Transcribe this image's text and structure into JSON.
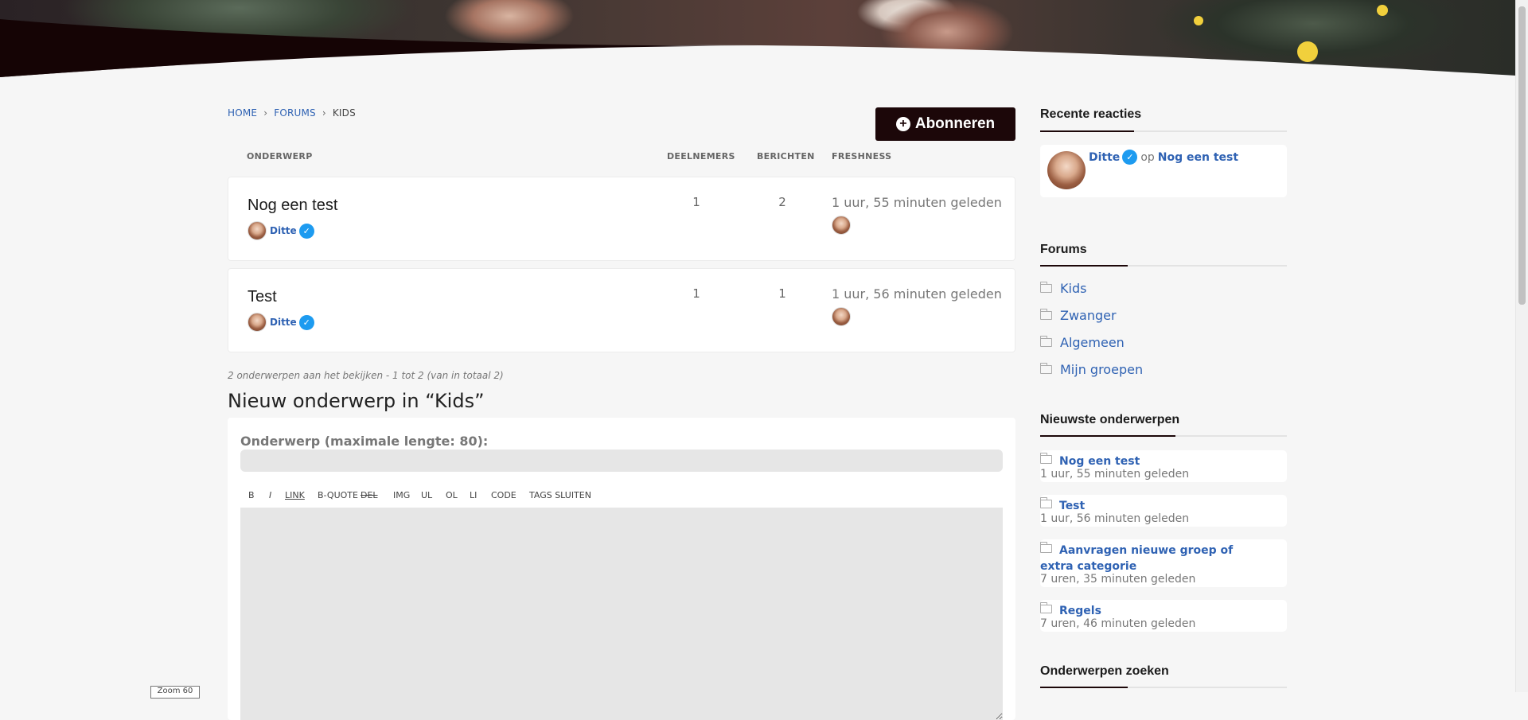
{
  "breadcrumb": {
    "home": "HOME",
    "forums": "FORUMS",
    "current": "KIDS",
    "sep": "›"
  },
  "subscribe_label": "Abonneren",
  "table_headers": {
    "topic": "ONDERWERP",
    "participants": "DEELNEMERS",
    "posts": "BERICHTEN",
    "freshness": "FRESHNESS"
  },
  "topics": [
    {
      "title": "Nog een test",
      "author": "Ditte",
      "participants": "1",
      "posts": "2",
      "freshness": "1 uur, 55 minuten geleden"
    },
    {
      "title": "Test",
      "author": "Ditte",
      "participants": "1",
      "posts": "1",
      "freshness": "1 uur, 56 minuten geleden"
    }
  ],
  "count_text": "2 onderwerpen aan het bekijken - 1 tot 2 (van in totaal 2)",
  "new_topic_heading": "Nieuw onderwerp in “Kids”",
  "form": {
    "subject_label": "Onderwerp (maximale lengte: 80):",
    "subject_value": "",
    "toolbar": [
      "B",
      "I",
      "LINK",
      "B-QUOTE",
      "DEL",
      "IMG",
      "UL",
      "OL",
      "LI",
      "CODE",
      "TAGS SLUITEN"
    ],
    "body_value": ""
  },
  "zoom_tag": "Zoom 60",
  "sidebar": {
    "recent_title": "Recente reacties",
    "recent": {
      "author": "Ditte",
      "connector": "op",
      "topic": "Nog een test"
    },
    "forums_title": "Forums",
    "forums": [
      "Kids",
      "Zwanger",
      "Algemeen",
      "Mijn groepen"
    ],
    "latest_title": "Nieuwste onderwerpen",
    "latest": [
      {
        "title": "Nog een test",
        "time": "1 uur, 55 minuten geleden"
      },
      {
        "title": "Test",
        "time": "1 uur, 56 minuten geleden"
      },
      {
        "title": "Aanvragen nieuwe groep of extra categorie",
        "time": "7 uren, 35 minuten geleden"
      },
      {
        "title": "Regels",
        "time": "7 uren, 46 minuten geleden"
      }
    ],
    "search_title": "Onderwerpen zoeken"
  },
  "colors": {
    "accent": "#2f62b3",
    "dark": "#1c0709",
    "verified": "#1d9bf0"
  },
  "icons": {
    "verified": "verified-check-icon",
    "folder": "folder-icon",
    "plus": "plus-circle-icon"
  }
}
